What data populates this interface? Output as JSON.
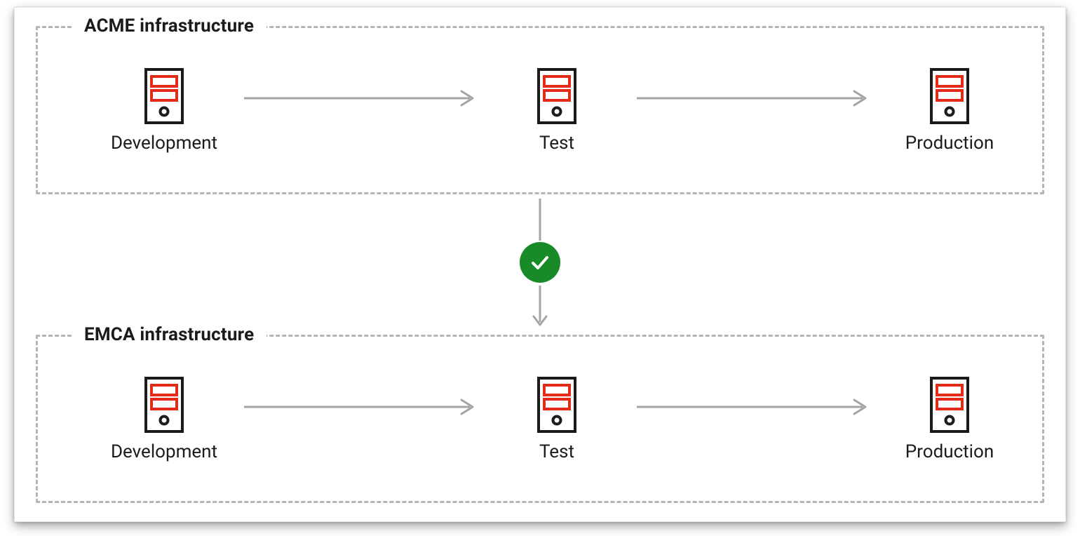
{
  "groups": [
    {
      "title": "ACME infrastructure",
      "nodes": [
        "Development",
        "Test",
        "Production"
      ]
    },
    {
      "title": "EMCA infrastructure",
      "nodes": [
        "Development",
        "Test",
        "Production"
      ]
    }
  ],
  "icons": {
    "server": "server-icon",
    "arrow_right": "arrow-right-icon",
    "arrow_down_split": "arrow-down-icon",
    "check": "check-icon"
  },
  "colors": {
    "server_outline": "#1b1b1b",
    "server_accent": "#e22b18",
    "arrow": "#a5a5a5",
    "dashed_border": "#b5b5b5",
    "check_bg": "#188a27",
    "check_fg": "#ffffff"
  }
}
